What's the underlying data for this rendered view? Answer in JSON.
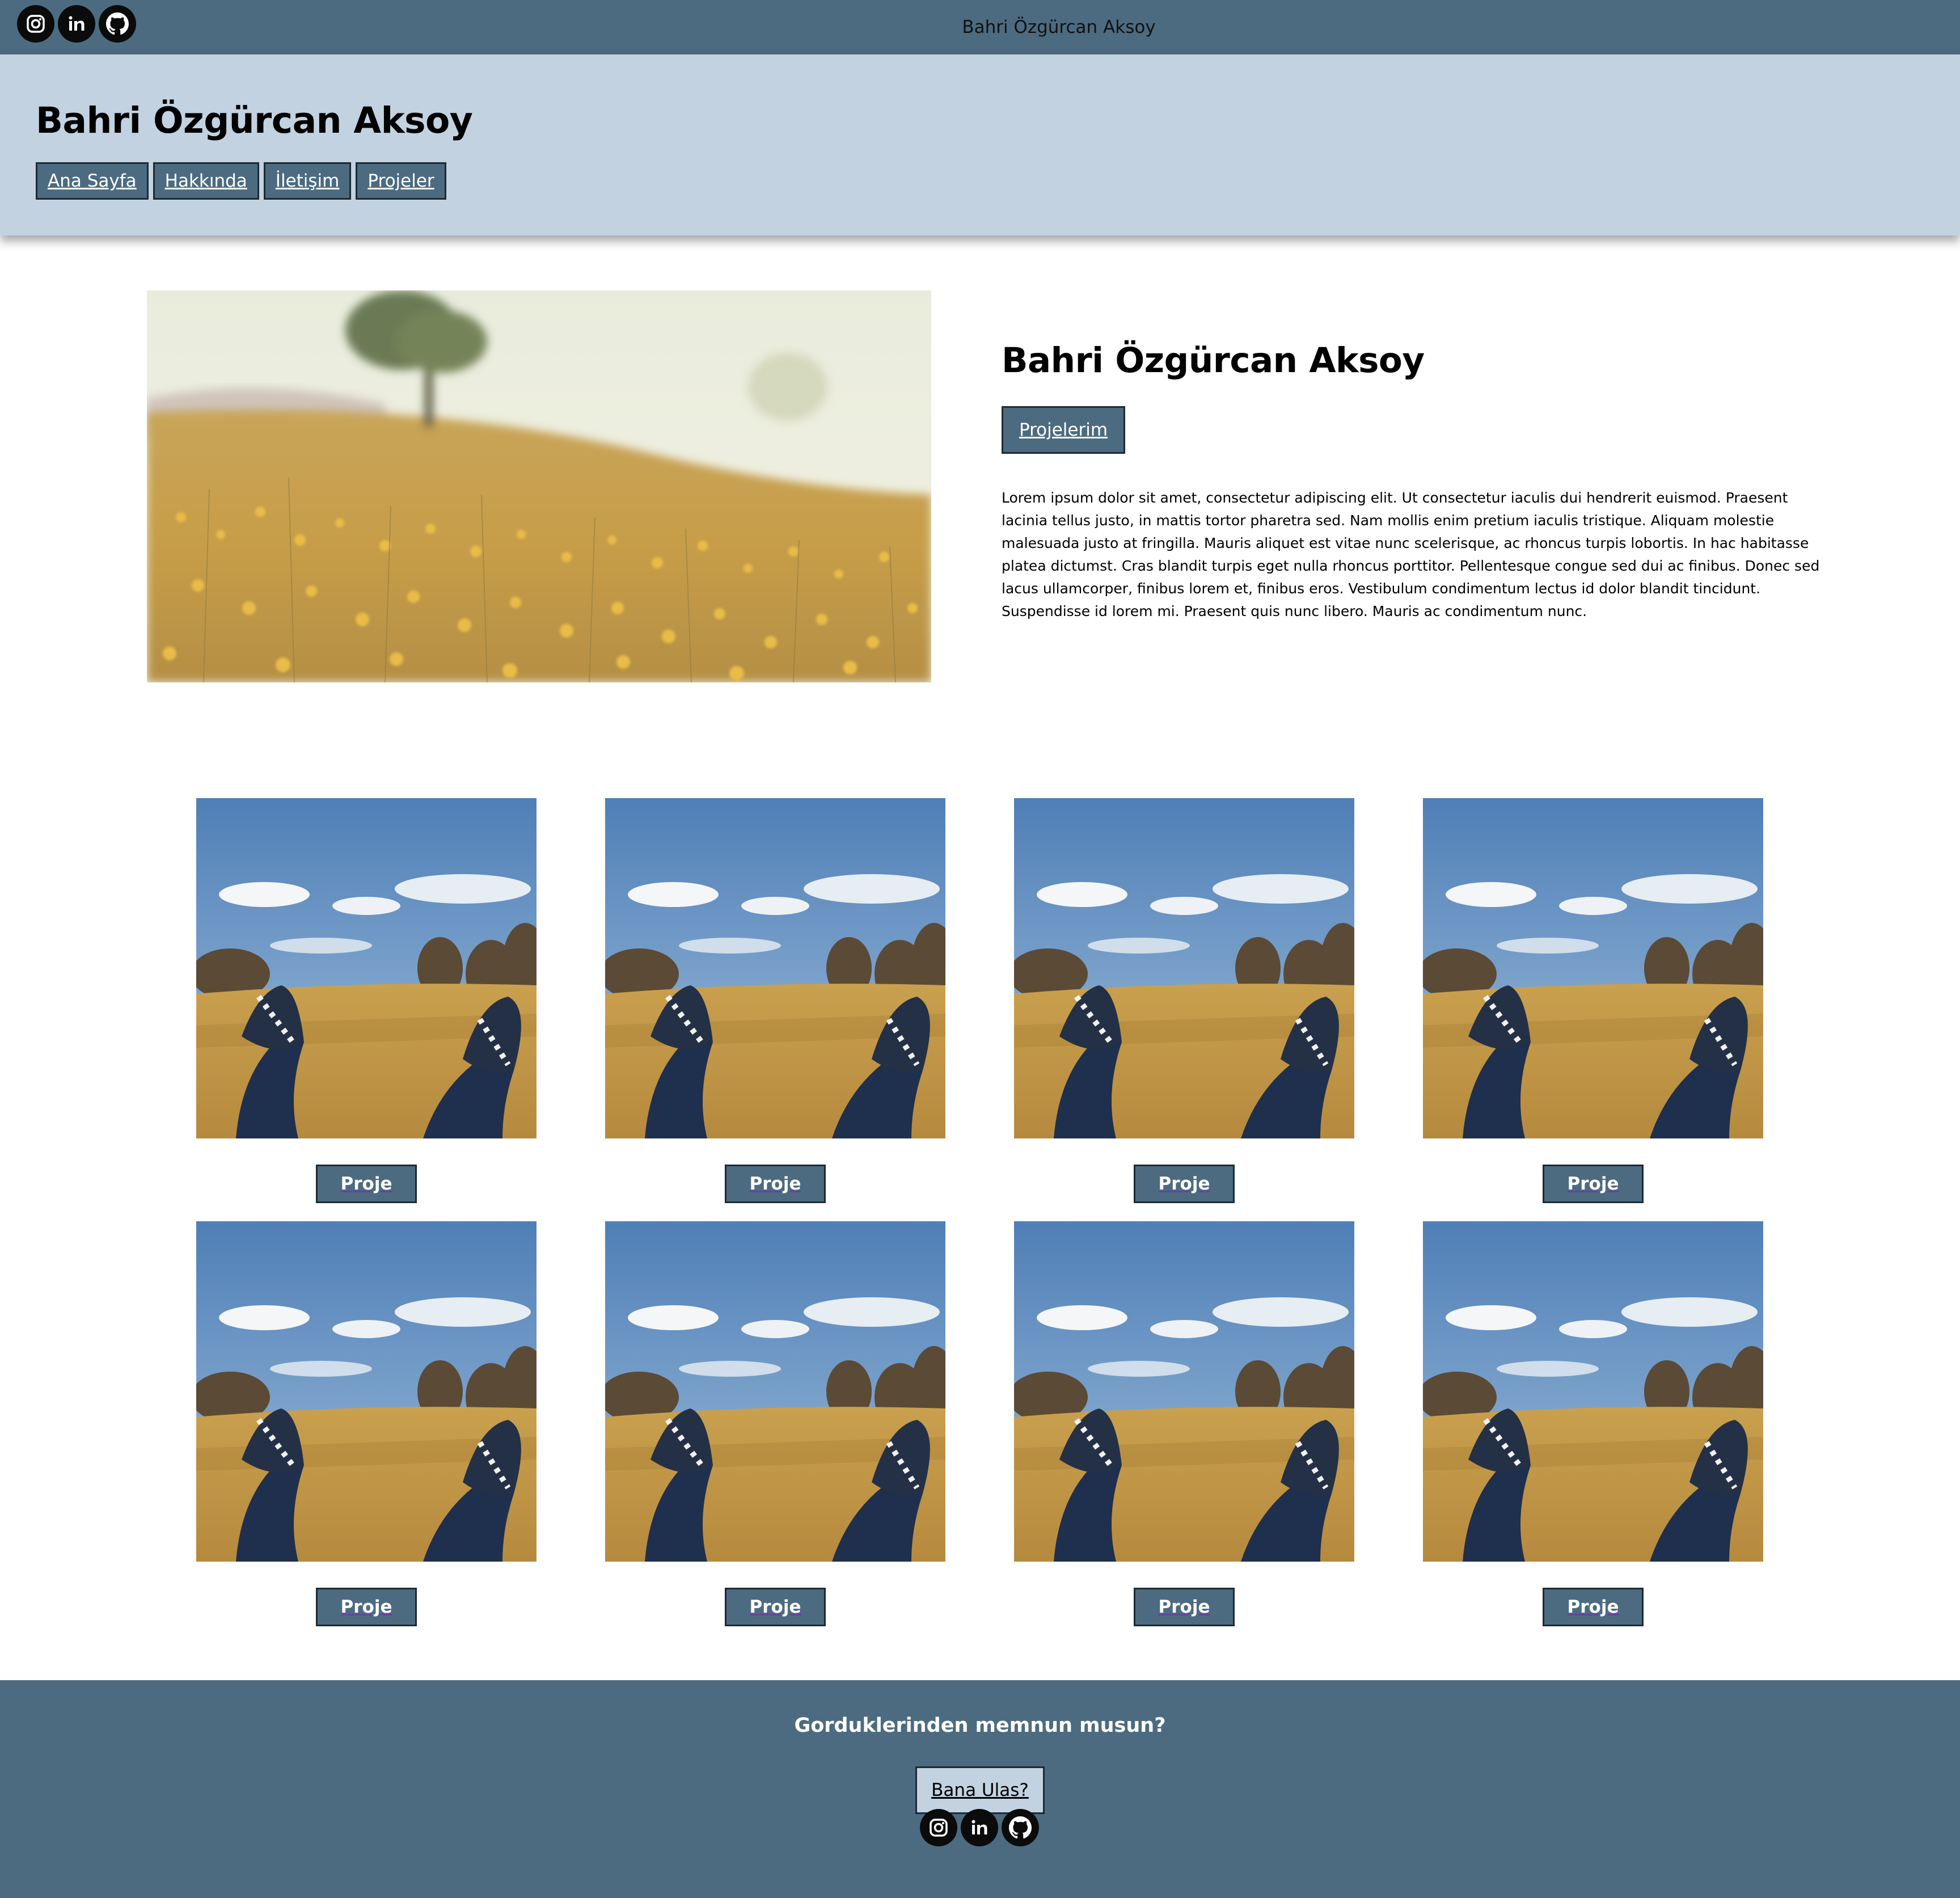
{
  "topbar": {
    "site_name": "Bahri Özgürcan Aksoy",
    "social": [
      "instagram-icon",
      "linkedin-icon",
      "github-icon"
    ]
  },
  "header": {
    "title": "Bahri Özgürcan Aksoy",
    "nav": [
      "Ana Sayfa",
      "Hakkında",
      "İletişim",
      "Projeler"
    ]
  },
  "hero": {
    "title": "Bahri Özgürcan Aksoy",
    "button": "Projelerim",
    "text": "Lorem ipsum dolor sit amet, consectetur adipiscing elit. Ut consectetur iaculis dui hendrerit euismod. Praesent lacinia tellus justo, in mattis tortor pharetra sed. Nam mollis enim pretium iaculis tristique. Aliquam molestie malesuada justo at fringilla. Mauris aliquet est vitae nunc scelerisque, ac rhoncus turpis lobortis. In hac habitasse platea dictumst. Cras blandit turpis eget nulla rhoncus porttitor. Pellentesque congue sed dui ac finibus. Donec sed lacus ullamcorper, finibus lorem et, finibus eros. Vestibulum condimentum lectus id dolor blandit tincidunt. Suspendisse id lorem mi. Praesent quis nunc libero. Mauris ac condimentum nunc."
  },
  "projects": {
    "button_label": "Proje",
    "count": 8
  },
  "footer": {
    "question": "Gorduklerinden memnun musun?",
    "button": "Bana Ulas?",
    "social": [
      "instagram-icon",
      "linkedin-icon",
      "github-icon"
    ]
  },
  "colors": {
    "primary": "#4c6b80",
    "header_bg": "#c3d2e1",
    "border": "#1c2a33"
  }
}
